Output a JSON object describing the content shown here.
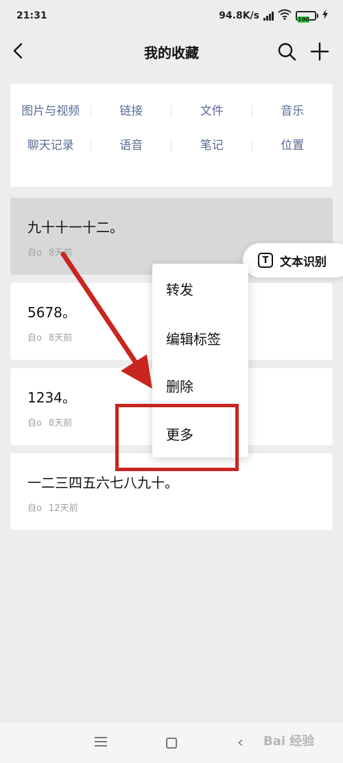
{
  "status_bar": {
    "time": "21:31",
    "network_speed": "94.8K/s",
    "network_tag": "HD",
    "battery_level": "100"
  },
  "top_bar": {
    "title": "我的收藏"
  },
  "categories": [
    "图片与视频",
    "链接",
    "文件",
    "音乐",
    "聊天记录",
    "语音",
    "笔记",
    "位置"
  ],
  "favorites": [
    {
      "text": "九十十一十二。",
      "source": "自o",
      "time": "8天前"
    },
    {
      "text": "5678。",
      "source": "自o",
      "time": "8天前"
    },
    {
      "text": "1234。",
      "source": "自o",
      "time": "8天前"
    },
    {
      "text": "一二三四五六七八九十。",
      "source": "自o",
      "time": "12天前"
    }
  ],
  "ocr_chip": {
    "icon_glyph": "T",
    "label": "文本识别"
  },
  "context_menu": [
    "转发",
    "编辑标签",
    "删除",
    "更多"
  ],
  "watermark": "Bai 经验",
  "colors": {
    "background": "#ededed",
    "category_text": "#576b95",
    "highlight": "#d8d8d8",
    "annotation_red": "#c8261f"
  }
}
